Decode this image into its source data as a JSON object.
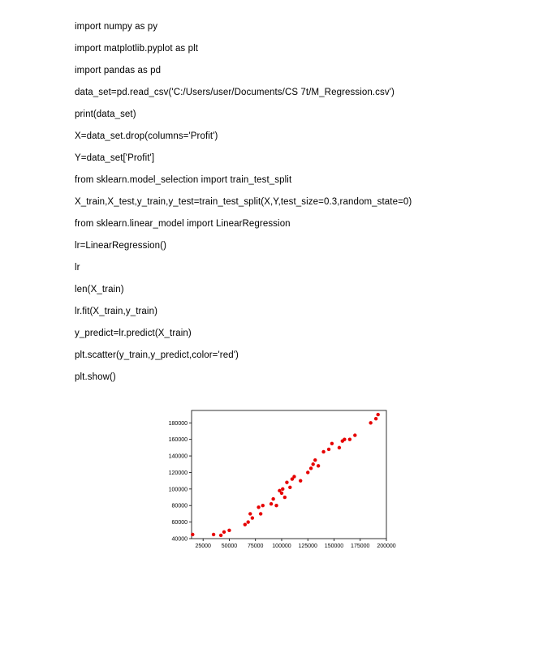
{
  "code": {
    "lines": [
      "import numpy as py",
      "import matplotlib.pyplot as plt",
      "import pandas as pd",
      "data_set=pd.read_csv('C:/Users/user/Documents/CS 7t/M_Regression.csv')",
      "print(data_set)",
      "X=data_set.drop(columns='Profit')",
      "Y=data_set['Profit']",
      "from sklearn.model_selection import train_test_split",
      "X_train,X_test,y_train,y_test=train_test_split(X,Y,test_size=0.3,random_state=0)",
      "from sklearn.linear_model import LinearRegression",
      "lr=LinearRegression()",
      "lr",
      "len(X_train)",
      "lr.fit(X_train,y_train)",
      "y_predict=lr.predict(X_train)",
      "plt.scatter(y_train,y_predict,color='red')",
      "plt.show()"
    ]
  },
  "chart_data": {
    "type": "scatter",
    "xlabel": "",
    "ylabel": "",
    "xlim": [
      14000,
      200000
    ],
    "ylim": [
      40000,
      195000
    ],
    "xticks": [
      25000,
      50000,
      75000,
      100000,
      125000,
      150000,
      175000,
      200000
    ],
    "yticks": [
      40000,
      60000,
      80000,
      100000,
      120000,
      140000,
      160000,
      180000
    ],
    "xtick_labels": [
      "25000",
      "50000",
      "75000",
      "100000",
      "125000",
      "150000",
      "175000",
      "200000"
    ],
    "ytick_labels": [
      "40000",
      "60000",
      "80000",
      "100000",
      "120000",
      "140000",
      "160000",
      "180000"
    ],
    "color": "#e60000",
    "data": [
      {
        "x": 15000,
        "y": 45000
      },
      {
        "x": 35000,
        "y": 45000
      },
      {
        "x": 42000,
        "y": 44000
      },
      {
        "x": 45000,
        "y": 48000
      },
      {
        "x": 50000,
        "y": 50000
      },
      {
        "x": 65000,
        "y": 57000
      },
      {
        "x": 68000,
        "y": 60000
      },
      {
        "x": 70000,
        "y": 70000
      },
      {
        "x": 72000,
        "y": 65000
      },
      {
        "x": 78000,
        "y": 78000
      },
      {
        "x": 80000,
        "y": 70000
      },
      {
        "x": 82000,
        "y": 80000
      },
      {
        "x": 90000,
        "y": 82000
      },
      {
        "x": 92000,
        "y": 88000
      },
      {
        "x": 95000,
        "y": 80000
      },
      {
        "x": 98000,
        "y": 98000
      },
      {
        "x": 100000,
        "y": 95000
      },
      {
        "x": 101000,
        "y": 100000
      },
      {
        "x": 103000,
        "y": 90000
      },
      {
        "x": 105000,
        "y": 108000
      },
      {
        "x": 108000,
        "y": 102000
      },
      {
        "x": 110000,
        "y": 112000
      },
      {
        "x": 112000,
        "y": 115000
      },
      {
        "x": 118000,
        "y": 110000
      },
      {
        "x": 125000,
        "y": 120000
      },
      {
        "x": 128000,
        "y": 125000
      },
      {
        "x": 130000,
        "y": 130000
      },
      {
        "x": 132000,
        "y": 135000
      },
      {
        "x": 135000,
        "y": 128000
      },
      {
        "x": 140000,
        "y": 145000
      },
      {
        "x": 145000,
        "y": 148000
      },
      {
        "x": 148000,
        "y": 155000
      },
      {
        "x": 155000,
        "y": 150000
      },
      {
        "x": 158000,
        "y": 158000
      },
      {
        "x": 160000,
        "y": 160000
      },
      {
        "x": 165000,
        "y": 160000
      },
      {
        "x": 170000,
        "y": 165000
      },
      {
        "x": 185000,
        "y": 180000
      },
      {
        "x": 190000,
        "y": 185000
      },
      {
        "x": 192000,
        "y": 190000
      }
    ]
  }
}
